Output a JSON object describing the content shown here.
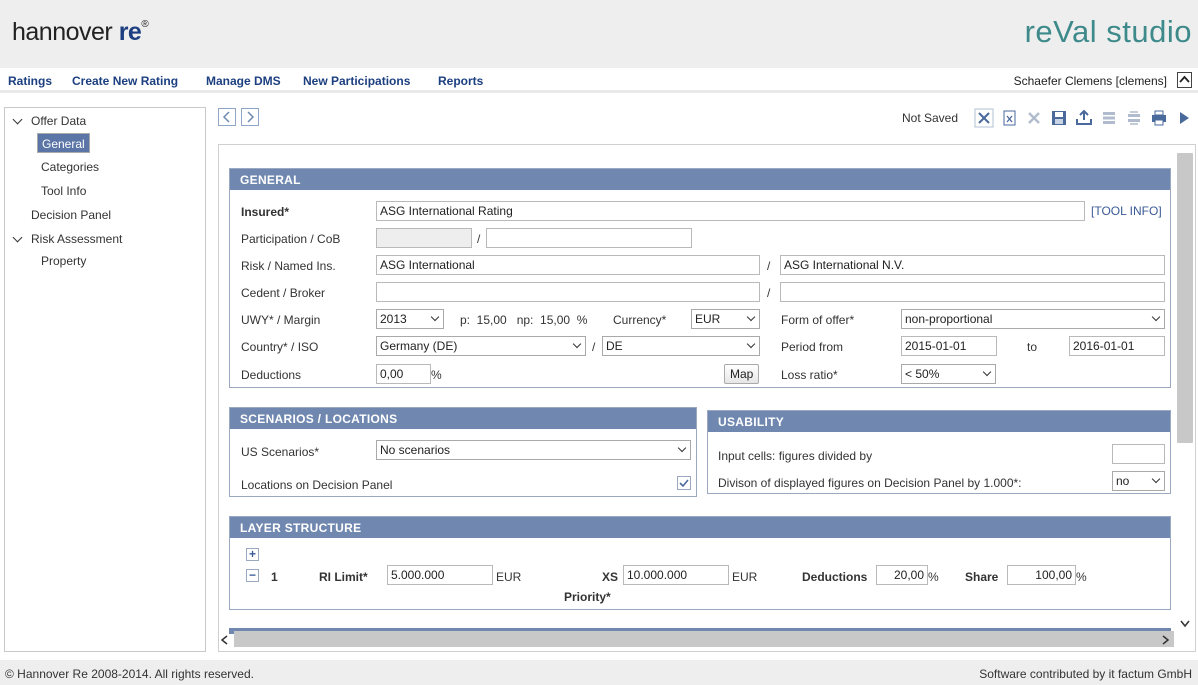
{
  "header": {
    "brand_main": "hannover",
    "brand_accent": "re",
    "brand_mark": "®",
    "app_name": "reVal studio"
  },
  "nav": {
    "links": [
      "Ratings",
      "Create New Rating",
      "Manage DMS",
      "New Participations",
      "Reports"
    ],
    "user": "Schaefer Clemens [clemens]"
  },
  "sidebar": {
    "offer_data": "Offer Data",
    "general": "General",
    "categories": "Categories",
    "tool_info": "Tool Info",
    "decision_panel": "Decision Panel",
    "risk_assessment": "Risk Assessment",
    "property": "Property"
  },
  "toolbar": {
    "status": "Not Saved"
  },
  "general": {
    "title": "GENERAL",
    "insured_label": "Insured*",
    "insured_value": "ASG International Rating",
    "tool_info_link": "[TOOL INFO]",
    "participation_label": "Participation / CoB",
    "participation_value": "",
    "cob_value": "",
    "slash": "/",
    "risk_label": "Risk / Named Ins.",
    "risk_value": "ASG International",
    "named_ins_value": "ASG International N.V.",
    "cedent_label": "Cedent / Broker",
    "cedent_value": "",
    "broker_value": "",
    "uwy_label": "UWY* / Margin",
    "uwy_value": "2013",
    "margin_text": "p:  15,00   np:  15,00  %",
    "currency_label": "Currency*",
    "currency_value": "EUR",
    "form_label": "Form of offer*",
    "form_value": "non-proportional",
    "country_label": "Country* / ISO",
    "country_value": "Germany (DE)",
    "iso_value": "DE",
    "period_label": "Period from",
    "period_from": "2015-01-01",
    "period_to_label": "to",
    "period_to": "2016-01-01",
    "deductions_label": "Deductions",
    "deductions_value": "0,00",
    "percent": "%",
    "map_button": "Map",
    "loss_ratio_label": "Loss ratio*",
    "loss_ratio_value": "< 50%"
  },
  "scenarios": {
    "title": "SCENARIOS / LOCATIONS",
    "us_label": "US Scenarios*",
    "us_value": "No scenarios",
    "locations_label": "Locations on Decision Panel",
    "locations_checked": true
  },
  "usability": {
    "title": "USABILITY",
    "input_cells_label": "Input cells: figures divided by",
    "input_cells_value": "",
    "division_label": "Divison of displayed figures on Decision Panel by 1.000*:",
    "division_value": "no"
  },
  "layer": {
    "title": "LAYER STRUCTURE",
    "number": "1",
    "ri_limit_label": "RI Limit*",
    "ri_limit_value": "5.000.000",
    "currency": "EUR",
    "xs_label": "XS",
    "xs_value": "10.000.000",
    "priority_label": "Priority*",
    "deductions_label": "Deductions",
    "deductions_value": "20,00",
    "share_label": "Share",
    "share_value": "100,00",
    "percent": "%"
  },
  "footer": {
    "copyright": "© Hannover Re 2008-2014. All rights reserved.",
    "credit": "Software contributed by it factum GmbH"
  },
  "colors": {
    "brand_blue": "#1c3f80",
    "app_teal": "#3e8a8a",
    "section_header": "#7088b0",
    "selected_item": "#5a75a6"
  }
}
